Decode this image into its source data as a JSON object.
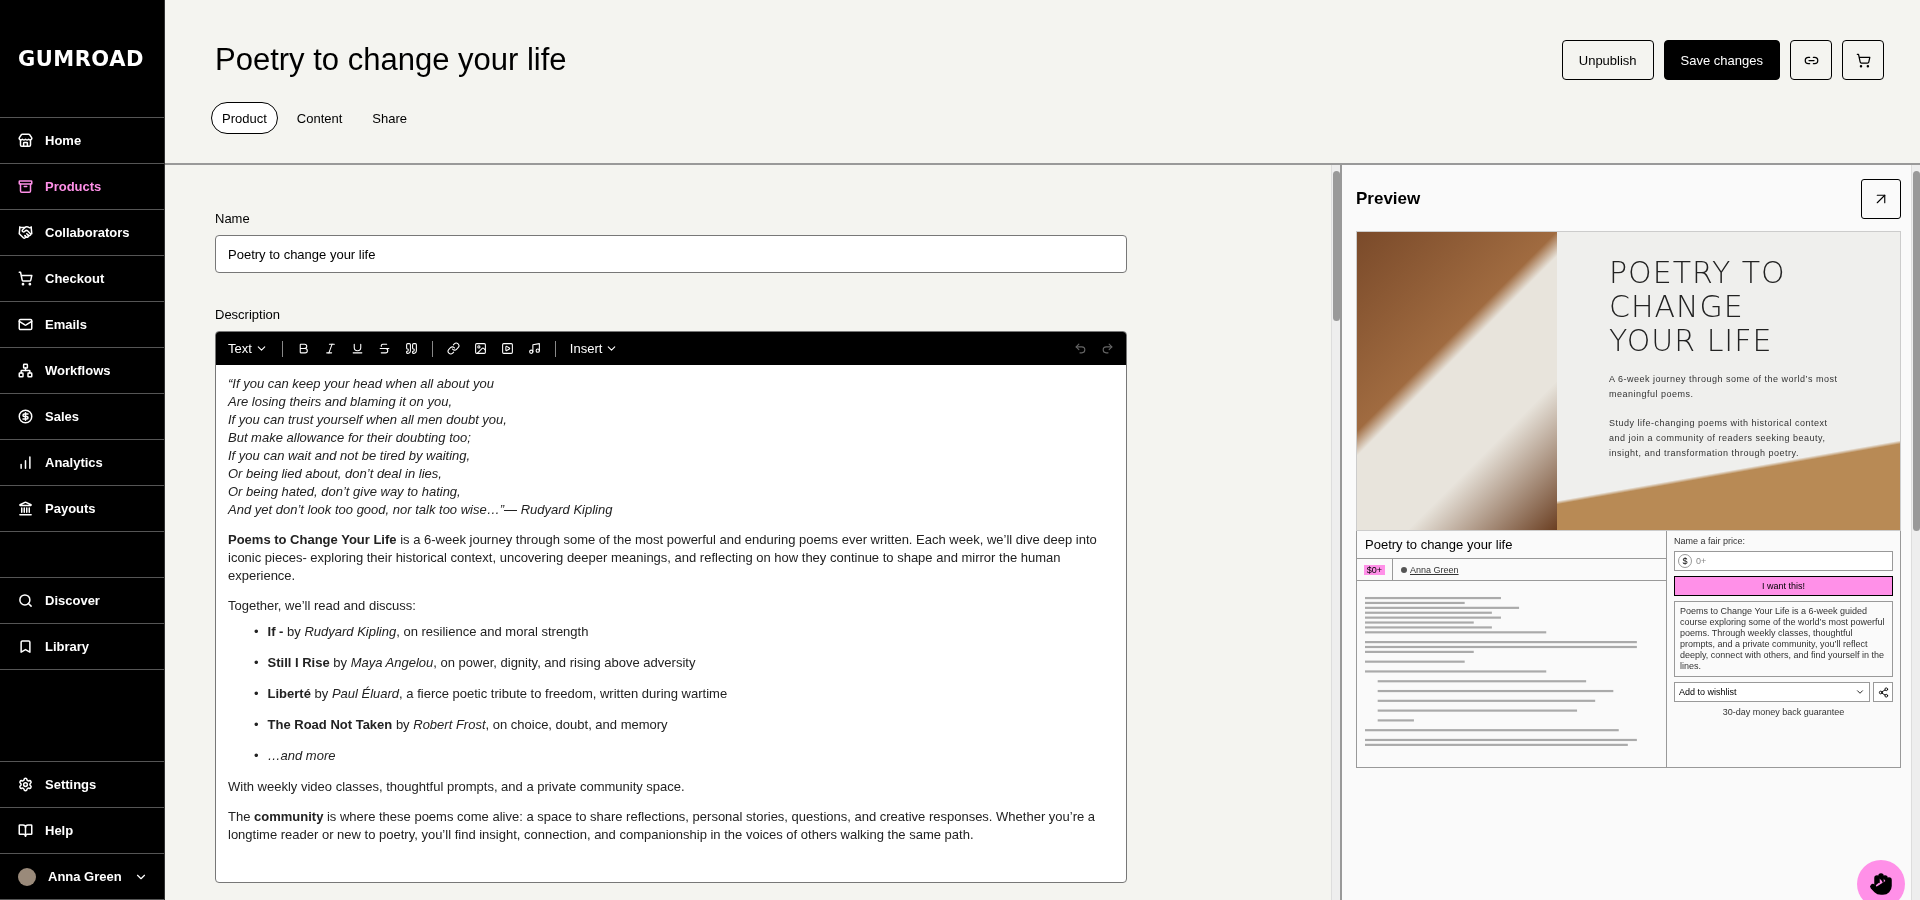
{
  "sidebar": {
    "logo": "GUMROAD",
    "primary": [
      {
        "label": "Home",
        "selected": false
      },
      {
        "label": "Products",
        "selected": true
      },
      {
        "label": "Collaborators",
        "selected": false
      },
      {
        "label": "Checkout",
        "selected": false
      },
      {
        "label": "Emails",
        "selected": false
      },
      {
        "label": "Workflows",
        "selected": false
      },
      {
        "label": "Sales",
        "selected": false
      },
      {
        "label": "Analytics",
        "selected": false
      },
      {
        "label": "Payouts",
        "selected": false
      }
    ],
    "secondary": [
      {
        "label": "Discover",
        "selected": false
      },
      {
        "label": "Library",
        "selected": false
      }
    ],
    "bottom": [
      {
        "label": "Settings",
        "selected": false
      },
      {
        "label": "Help",
        "selected": false
      }
    ],
    "user": {
      "name": "Anna Green"
    }
  },
  "header": {
    "title": "Poetry to change your life",
    "actions": [
      {
        "kind": "outline",
        "label": "Unpublish"
      },
      {
        "kind": "primary",
        "label": "Save changes"
      },
      {
        "kind": "icon-link"
      },
      {
        "kind": "icon-cart"
      }
    ],
    "tabs": [
      {
        "label": "Product",
        "selected": true
      },
      {
        "label": "Content",
        "selected": false
      },
      {
        "label": "Share",
        "selected": false
      }
    ]
  },
  "form": {
    "name_label": "Name",
    "name_value": "Poetry to change your life",
    "description_label": "Description",
    "toolbar": {
      "text_menu": "Text",
      "insert_menu": "Insert",
      "undo_disabled": true,
      "redo_disabled": true
    },
    "poem": [
      "“If you can keep your head when all about you",
      "Are losing theirs and blaming it on you,",
      "If you can trust yourself when all men doubt you,",
      "But make allowance for their doubting too;",
      "If you can wait and not be tired by waiting,",
      "Or being lied about, don’t deal in lies,",
      "Or being hated, don’t give way to hating,",
      "And yet don’t look too good, nor talk too wise…”— Rudyard Kipling"
    ],
    "blocks": [
      {
        "kind": "paragraph",
        "text": "**Poems to Change Your Life** is a 6-week journey through some of the most powerful and enduring poems ever written. Each week, we’ll dive deep into iconic pieces- exploring their historical context, uncovering deeper meanings, and reflecting on how they continue to shape and mirror the human experience."
      },
      {
        "kind": "paragraph",
        "text": "Together, we’ll read and discuss:"
      },
      {
        "kind": "list",
        "marker": "•",
        "items": [
          "**If -** by *Rudyard Kipling*, on resilience and moral strength",
          "**Still I Rise** by *Maya Angelou*, on power, dignity, and rising above adversity",
          "**Liberté** by *Paul Éluard*, a fierce poetic tribute to freedom, written during wartime",
          "**The Road Not Taken** by *Robert Frost*, on choice, doubt, and memory",
          "*…and more*"
        ]
      },
      {
        "kind": "paragraph",
        "text": "With weekly video classes, thoughtful prompts, and a private community space."
      },
      {
        "kind": "paragraph",
        "text": "The **community** is where these poems come alive: a space to share reflections, personal stories, questions, and creative responses. Whether you’re a longtime reader or new to poetry, you’ll find insight, connection, and companionship in the voices of others walking the same path."
      }
    ]
  },
  "preview": {
    "title": "Preview",
    "cover": {
      "heading": [
        "POETRY TO",
        "CHANGE",
        "YOUR LIFE"
      ],
      "lines": [
        "A 6-week journey through some of the world’s most meaningful poems.",
        "Study life-changing poems with historical context and join a community of readers seeking beauty, insight, and transformation through poetry."
      ]
    },
    "product_title": "Poetry to change your life",
    "price_tag": "$0+",
    "seller": "Anna Green",
    "price_label": "Name a fair price:",
    "currency": "$",
    "price_placeholder": "0+",
    "buy_label": "I want this!",
    "summary": "Poems to Change Your Life is a 6-week guided course exploring some of the world’s most powerful poems. Through weekly classes, thoughtful prompts, and a private community, you’ll reflect deeply, connect with others, and find yourself in the lines.",
    "wishlist": "Add to wishlist",
    "guarantee": "30-day money back guarantee"
  }
}
